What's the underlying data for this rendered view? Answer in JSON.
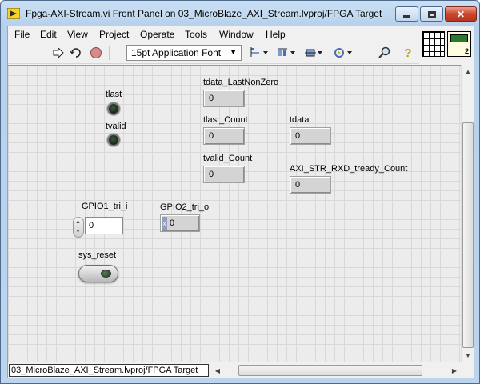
{
  "window": {
    "title": "Fpga-AXI-Stream.vi Front Panel on 03_MicroBlaze_AXI_Stream.lvproj/FPGA Target",
    "minimize_glyph": "",
    "maximize_glyph": "",
    "close_glyph": "✕"
  },
  "menubar": {
    "items": [
      {
        "label": "File"
      },
      {
        "label": "Edit"
      },
      {
        "label": "View"
      },
      {
        "label": "Project"
      },
      {
        "label": "Operate"
      },
      {
        "label": "Tools"
      },
      {
        "label": "Window"
      },
      {
        "label": "Help"
      }
    ]
  },
  "toolbar": {
    "run_icon": "run-arrow-icon",
    "run_continuous_icon": "run-continuously-icon",
    "abort_icon": "abort-icon",
    "font_select": {
      "value": "15pt Application Font",
      "arrow": "▼"
    },
    "align_icon": "align-objects-icon",
    "distribute_icon": "distribute-objects-icon",
    "resize_icon": "resize-objects-icon",
    "reorder_icon": "reorder-icon",
    "search_icon": "search-icon",
    "help_icon": "help-icon",
    "help_glyph": "?"
  },
  "vi_icon": {
    "pane_number": "2"
  },
  "panel": {
    "tlast": {
      "label": "tlast",
      "state": false
    },
    "tvalid": {
      "label": "tvalid",
      "state": false
    },
    "tdata_last_nonzero": {
      "label": "tdata_LastNonZero",
      "value": "0"
    },
    "tlast_count": {
      "label": "tlast_Count",
      "value": "0"
    },
    "tdata": {
      "label": "tdata",
      "value": "0"
    },
    "tvalid_count": {
      "label": "tvalid_Count",
      "value": "0"
    },
    "axi_str_rxd_tready_count": {
      "label": "AXI_STR_RXD_tready_Count",
      "value": "0"
    },
    "gpio1_tri_i": {
      "label": "GPIO1_tri_i",
      "value": "0"
    },
    "gpio2_tri_o": {
      "label": "GPIO2_tri_o",
      "value": "0",
      "radix": "x"
    },
    "sys_reset": {
      "label": "sys_reset",
      "state": false
    }
  },
  "status_bar": {
    "context": "03_MicroBlaze_AXI_Stream.lvproj/FPGA Target"
  },
  "scroll_glyphs": {
    "up": "▲",
    "down": "▼",
    "left": "◀",
    "right": "▶"
  },
  "colors": {
    "title_bar": "#bcd4ee",
    "close_button": "#c9452c",
    "panel_bg": "#ececec",
    "grid_line": "#d8d8d8",
    "led_off": "#1c2e1c"
  }
}
